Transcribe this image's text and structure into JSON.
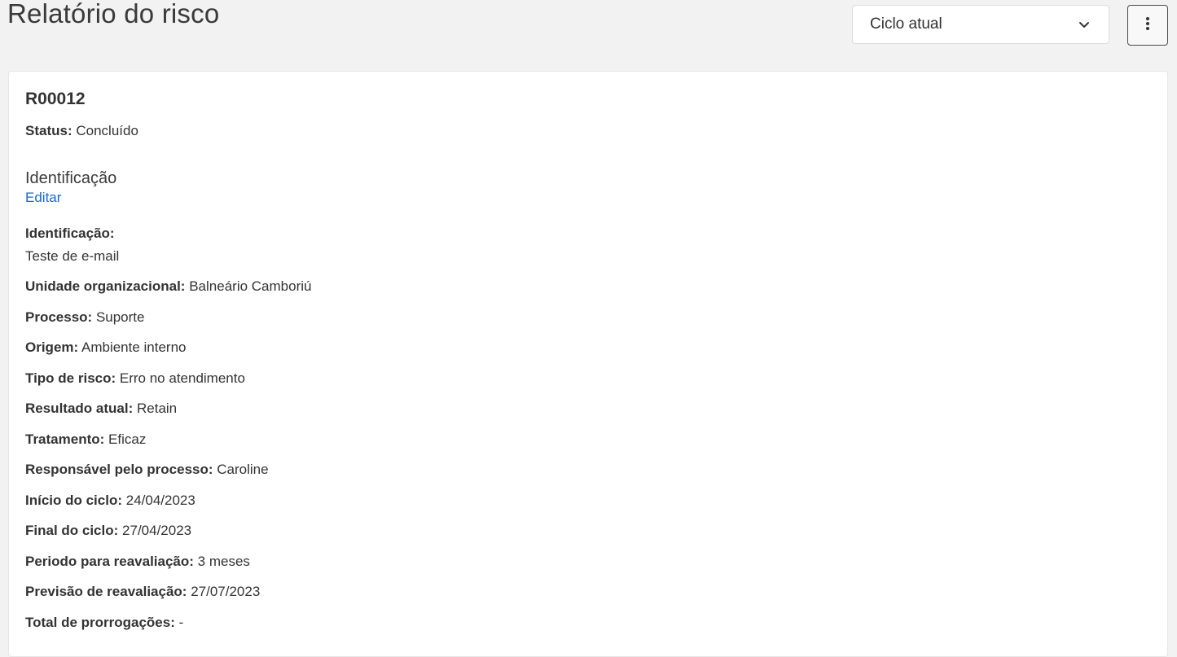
{
  "header": {
    "title": "Relatório do risco",
    "cycle_select": {
      "value": "Ciclo atual"
    }
  },
  "icons": {
    "chevron": "chevron-down-icon",
    "more": "vertical-dots-icon"
  },
  "risk": {
    "code": "R00012",
    "status_label": "Status:",
    "status_value": "Concluído"
  },
  "section": {
    "title": "Identificação",
    "edit_label": "Editar"
  },
  "fields": [
    {
      "label": "Identificação:",
      "value": "Teste de e-mail"
    },
    {
      "label": "Unidade organizacional:",
      "value": "Balneário Camboriú"
    },
    {
      "label": "Processo:",
      "value": "Suporte"
    },
    {
      "label": "Origem:",
      "value": "Ambiente interno"
    },
    {
      "label": "Tipo de risco:",
      "value": "Erro no atendimento"
    },
    {
      "label": "Resultado atual:",
      "value": "Retain"
    },
    {
      "label": "Tratamento:",
      "value": "Eficaz"
    },
    {
      "label": "Responsável pelo processo:",
      "value": "Caroline"
    },
    {
      "label": "Início do ciclo:",
      "value": "24/04/2023"
    },
    {
      "label": "Final do ciclo:",
      "value": "27/04/2023"
    },
    {
      "label": "Periodo para reavaliação:",
      "value": "3 meses"
    },
    {
      "label": "Previsão de reavaliação:",
      "value": "27/07/2023"
    },
    {
      "label": "Total de prorrogações:",
      "value": "-"
    }
  ]
}
